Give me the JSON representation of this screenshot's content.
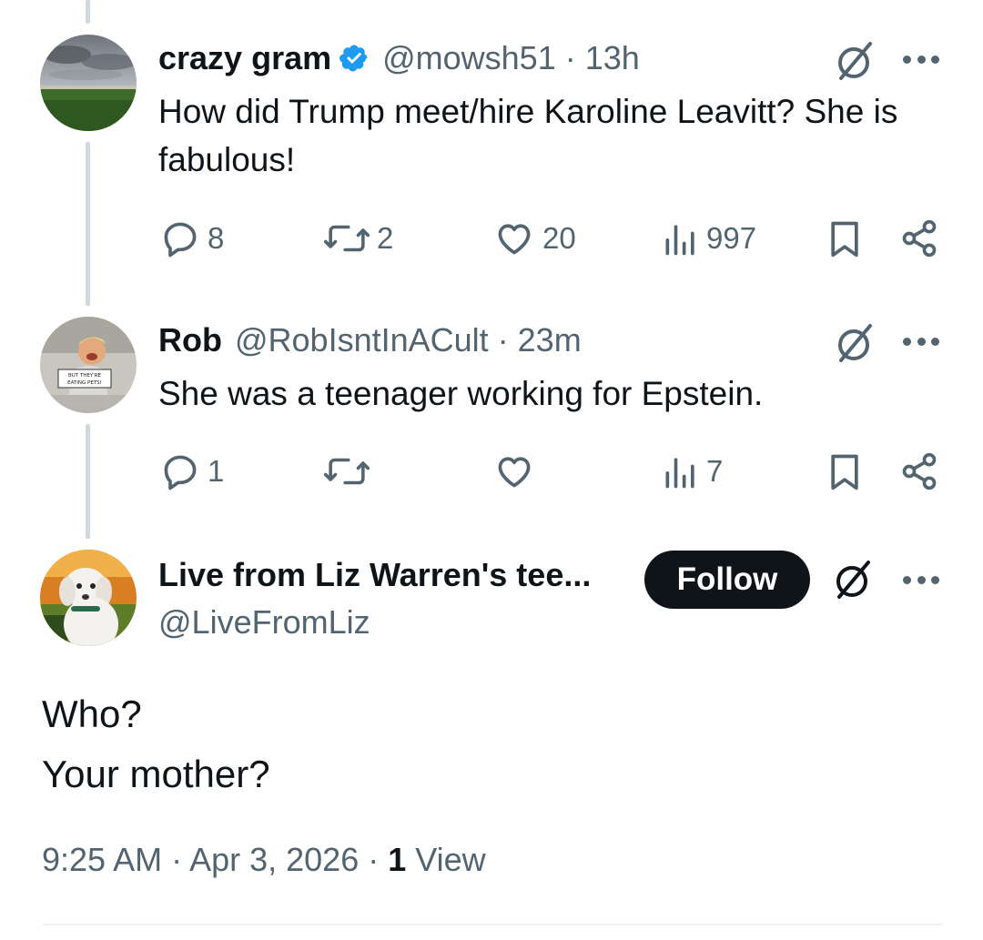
{
  "replies": [
    {
      "display_name": "crazy gram",
      "verified": true,
      "handle": "@mowsh51",
      "separator": "·",
      "time": "13h",
      "text": "How did Trump meet/hire Karoline Leavitt? She is fabulous!",
      "stats": {
        "replies": "8",
        "reposts": "2",
        "likes": "20",
        "views": "997"
      }
    },
    {
      "display_name": "Rob",
      "verified": false,
      "handle": "@RobIsntInACult",
      "separator": "·",
      "time": "23m",
      "text": "She was a teenager working for Epstein.",
      "stats": {
        "replies": "1",
        "reposts": "",
        "likes": "",
        "views": "7"
      },
      "avatar_caption": "BUT THEY'RE EATING PETS!"
    }
  ],
  "main_post": {
    "display_name": "Live from Liz Warren's tee...",
    "handle": "@LiveFromLiz",
    "follow_label": "Follow",
    "lines": [
      "Who?",
      "Your mother?"
    ],
    "timestamp": "9:25 AM · Apr 3, 2026 · ",
    "views_count": "1",
    "views_label": " View"
  },
  "icons": {
    "verified": "verified-badge-icon",
    "grok": "grok-icon",
    "more": "more-options-icon",
    "reply": "reply-icon",
    "repost": "repost-icon",
    "like": "like-icon",
    "views": "views-icon",
    "bookmark": "bookmark-icon",
    "share": "share-icon"
  },
  "colors": {
    "text_primary": "#0f1419",
    "text_secondary": "#536471",
    "verified_blue": "#1d9bf0",
    "thread_line": "#cfd9de",
    "follow_button_bg": "#0f1419"
  }
}
